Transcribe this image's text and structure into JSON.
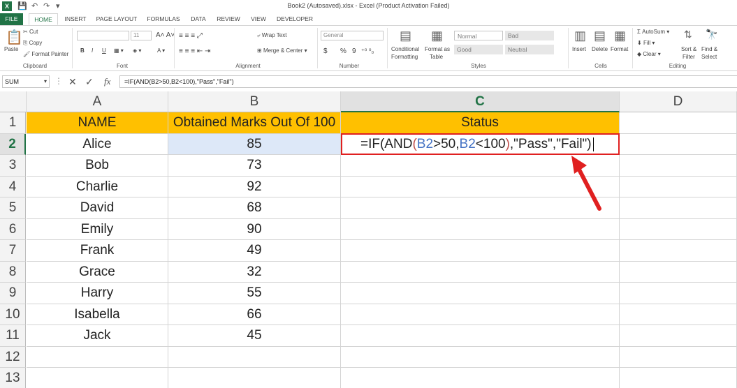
{
  "titlebar": {
    "title": "Book2 (Autosaved).xlsx - Excel (Product Activation Failed)"
  },
  "tabs": [
    "FILE",
    "HOME",
    "INSERT",
    "PAGE LAYOUT",
    "FORMULAS",
    "DATA",
    "REVIEW",
    "VIEW",
    "DEVELOPER"
  ],
  "ribbon": {
    "clipboard": {
      "paste": "Paste",
      "cut": "Cut",
      "copy": "Copy",
      "format_painter": "Format Painter",
      "label": "Clipboard"
    },
    "font": {
      "font_size": "11",
      "label": "Font",
      "bold": "B",
      "italic": "I",
      "underline": "U"
    },
    "alignment": {
      "wrap_text": "Wrap Text",
      "merge_center": "Merge & Center",
      "label": "Alignment"
    },
    "number": {
      "format": "General",
      "currency": "$",
      "percent": "%",
      "comma": "9",
      "label": "Number"
    },
    "styles": {
      "conditional": "Conditional",
      "conditional2": "Formatting",
      "format_as": "Format as",
      "format_as2": "Table",
      "normal": "Normal",
      "bad": "Bad",
      "good": "Good",
      "neutral": "Neutral",
      "label": "Styles"
    },
    "cells": {
      "insert": "Insert",
      "delete": "Delete",
      "format": "Format",
      "label": "Cells"
    },
    "editing": {
      "autosum": "AutoSum",
      "fill": "Fill",
      "clear": "Clear",
      "sort": "Sort &",
      "sort2": "Filter",
      "find": "Find &",
      "find2": "Select",
      "label": "Editing"
    }
  },
  "formula_bar": {
    "name_box": "SUM",
    "formula": "=IF(AND(B2>50,B2<100),\"Pass\",\"Fail\")"
  },
  "columns": [
    "A",
    "B",
    "C",
    "D"
  ],
  "rows": [
    "1",
    "2",
    "3",
    "4",
    "5",
    "6",
    "7",
    "8",
    "9",
    "10",
    "11",
    "12",
    "13"
  ],
  "table": {
    "headers": [
      "NAME",
      "Obtained Marks Out Of 100",
      "Status"
    ],
    "names": [
      "Alice",
      "Bob",
      "Charlie",
      "David",
      "Emily",
      "Frank",
      "Grace",
      "Harry",
      "Isabella",
      "Jack"
    ],
    "marks": [
      "85",
      "73",
      "92",
      "68",
      "90",
      "49",
      "32",
      "55",
      "66",
      "45"
    ]
  },
  "edit_cell": {
    "p1": "=IF(AND",
    "paren_open": "(",
    "ref_a": "B2",
    "mid": ">50,",
    "ref_b": "B2",
    "lt": "<100",
    "paren_close": ")",
    "tail": ",\"Pass\",\"Fail\")"
  },
  "colors": {
    "header_fill": "#ffc000",
    "excel_green": "#217346",
    "highlight": "#dde8f8",
    "annotation": "#e02020"
  }
}
